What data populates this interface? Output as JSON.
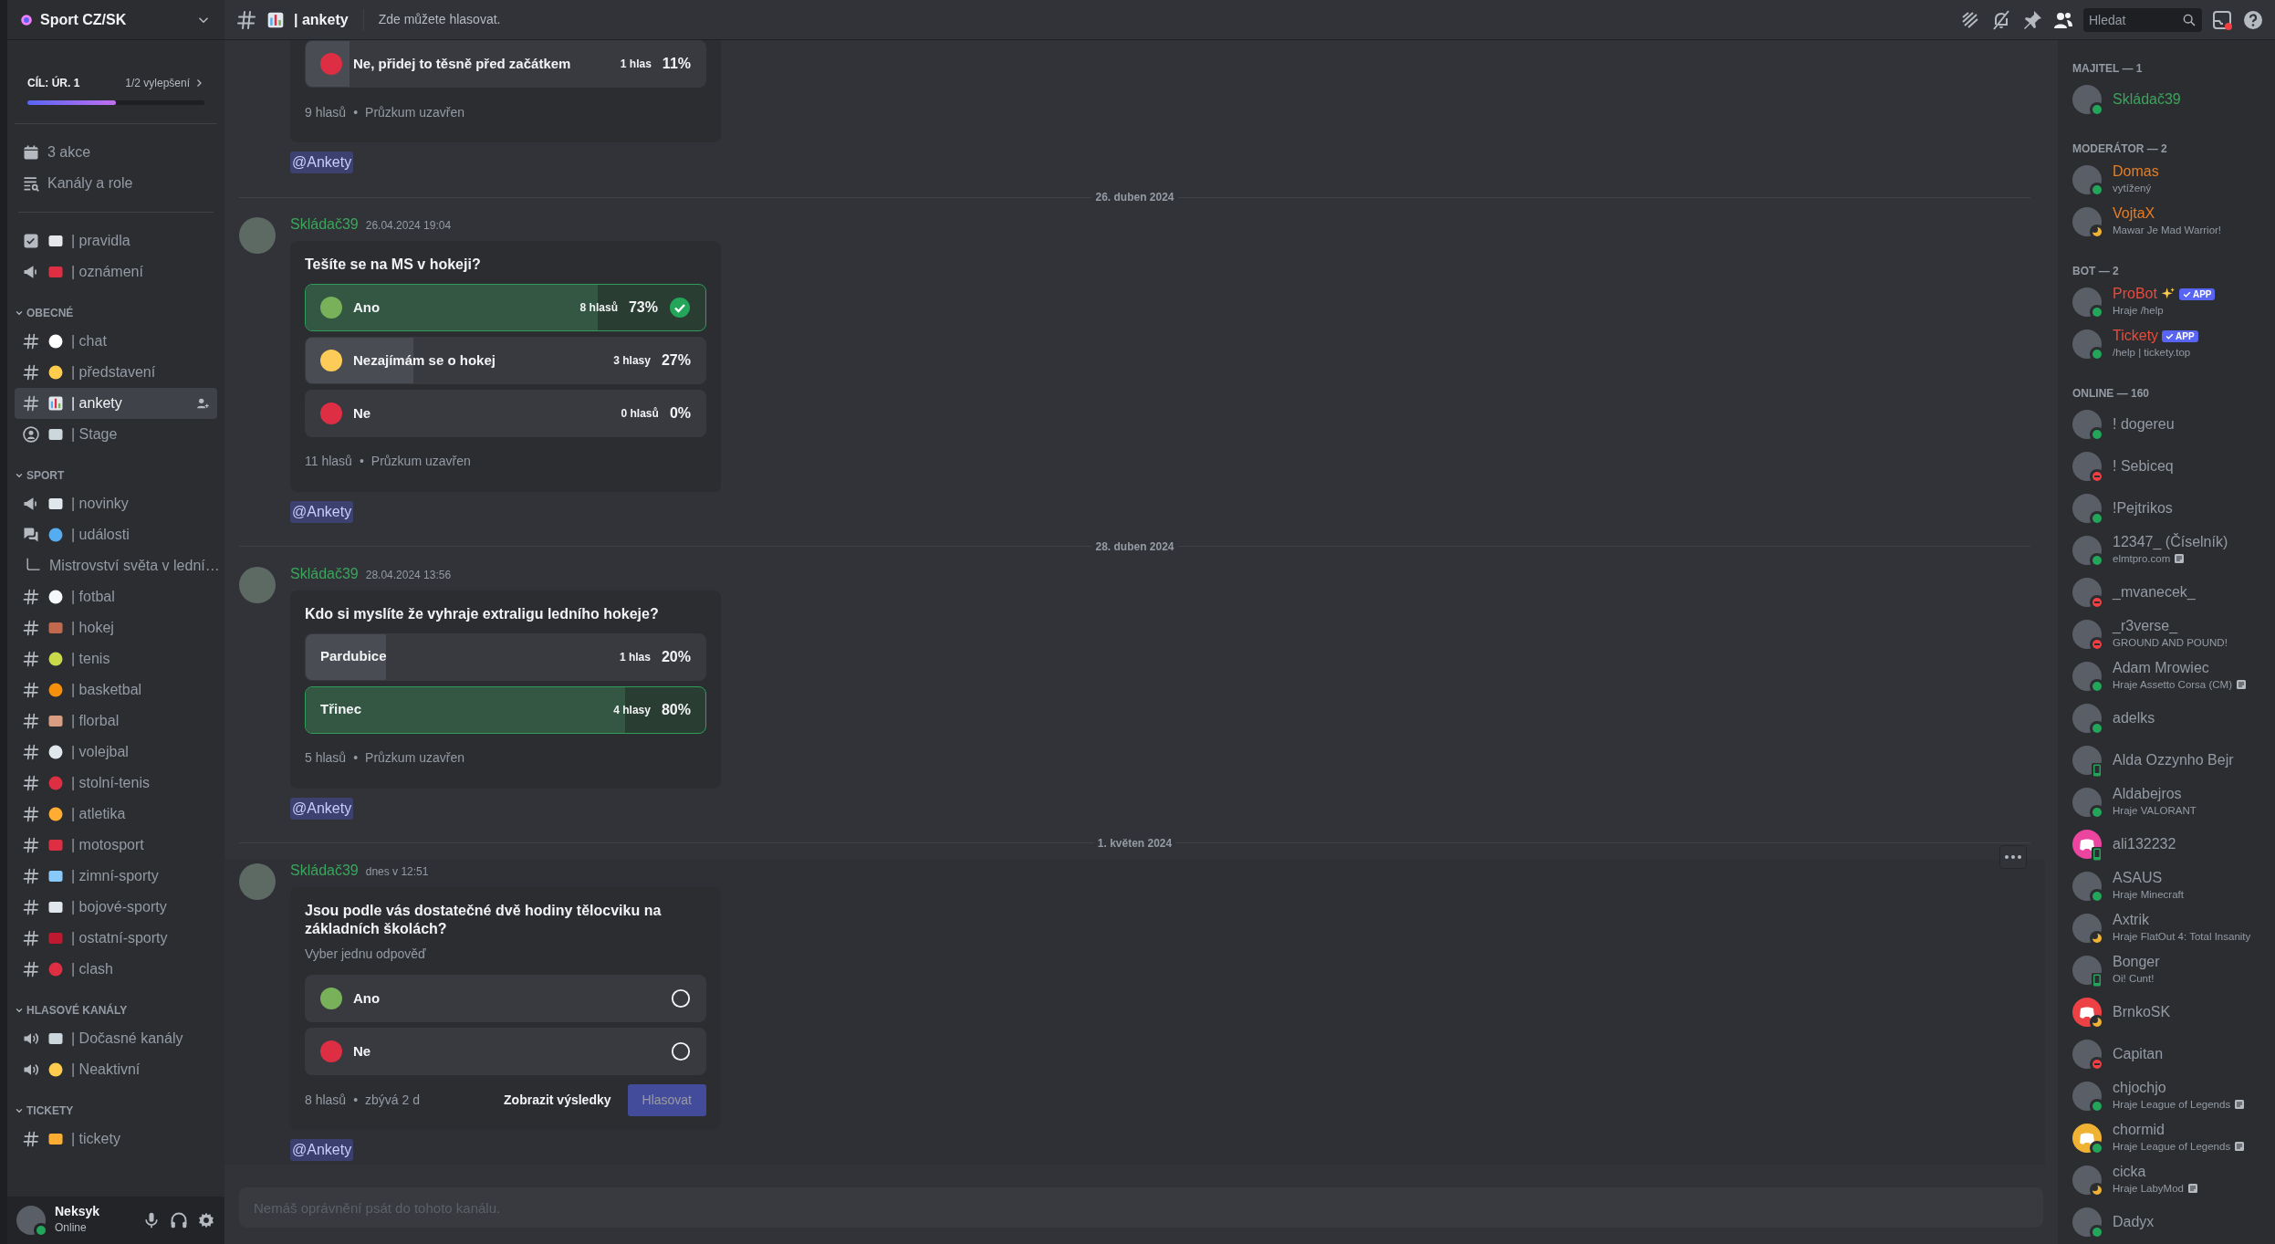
{
  "server": {
    "name": "Sport CZ/SK"
  },
  "boost": {
    "goal": "CÍL: ÚR. 1",
    "progress": "1/2 vylepšení",
    "level": 0.5
  },
  "shortcuts": [
    {
      "kind": "events",
      "label": "3 akce"
    },
    {
      "kind": "browse",
      "label": "Kanály a role"
    }
  ],
  "top_channels": [
    {
      "kind": "rules",
      "emoji": {
        "kind": "page"
      },
      "label": "| pravidla",
      "selected": false
    },
    {
      "kind": "announcement",
      "emoji": {
        "kind": "megaphone"
      },
      "label": "| oznámení",
      "selected": false
    }
  ],
  "categories": [
    {
      "name": "OBECNÉ",
      "expanded": true,
      "channels": [
        {
          "kind": "text",
          "emoji": {
            "kind": "speech"
          },
          "label": "| chat",
          "selected": false
        },
        {
          "kind": "text",
          "emoji": {
            "kind": "wave"
          },
          "label": "| představení",
          "selected": false
        },
        {
          "kind": "text",
          "emoji": {
            "kind": "chart"
          },
          "label": "| ankety",
          "selected": true
        },
        {
          "kind": "stage",
          "emoji": {
            "kind": "speaker"
          },
          "label": "| Stage",
          "selected": false
        }
      ]
    },
    {
      "name": "SPORT",
      "expanded": true,
      "channels": [
        {
          "kind": "announcement",
          "emoji": {
            "kind": "newspaper"
          },
          "label": "| novinky",
          "selected": false
        },
        {
          "kind": "forum",
          "emoji": {
            "kind": "globe"
          },
          "label": "| události",
          "selected": false
        },
        {
          "kind": "thread",
          "label": "Mistrovství světa v lední…",
          "selected": false
        },
        {
          "kind": "text",
          "emoji": {
            "kind": "soccer"
          },
          "label": "| fotbal",
          "selected": false
        },
        {
          "kind": "text",
          "emoji": {
            "kind": "hockey"
          },
          "label": "| hokej",
          "selected": false
        },
        {
          "kind": "text",
          "emoji": {
            "kind": "tennis"
          },
          "label": "| tenis",
          "selected": false
        },
        {
          "kind": "text",
          "emoji": {
            "kind": "basketball"
          },
          "label": "| basketbal",
          "selected": false
        },
        {
          "kind": "text",
          "emoji": {
            "kind": "stick"
          },
          "label": "| florbal",
          "selected": false
        },
        {
          "kind": "text",
          "emoji": {
            "kind": "volleyball"
          },
          "label": "| volejbal",
          "selected": false
        },
        {
          "kind": "text",
          "emoji": {
            "kind": "pingpong"
          },
          "label": "| stolní-tenis",
          "selected": false
        },
        {
          "kind": "text",
          "emoji": {
            "kind": "runner"
          },
          "label": "| atletika",
          "selected": false
        },
        {
          "kind": "text",
          "emoji": {
            "kind": "car"
          },
          "label": "| motosport",
          "selected": false
        },
        {
          "kind": "text",
          "emoji": {
            "kind": "snowboard"
          },
          "label": "| zimní-sporty",
          "selected": false
        },
        {
          "kind": "text",
          "emoji": {
            "kind": "gi"
          },
          "label": "| bojové-sporty",
          "selected": false
        },
        {
          "kind": "text",
          "emoji": {
            "kind": "goal"
          },
          "label": "| ostatní-sporty",
          "selected": false
        },
        {
          "kind": "text",
          "emoji": {
            "kind": "glove"
          },
          "label": "| clash",
          "selected": false
        }
      ]
    },
    {
      "name": "HLASOVÉ KANÁLY",
      "expanded": true,
      "channels": [
        {
          "kind": "voice",
          "emoji": {
            "kind": "speaker"
          },
          "label": "| Dočasné kanály",
          "selected": false
        },
        {
          "kind": "voice",
          "emoji": {
            "kind": "sleepy"
          },
          "label": "| Neaktivní",
          "selected": false
        }
      ]
    },
    {
      "name": "TICKETY",
      "expanded": true,
      "channels": [
        {
          "kind": "text",
          "emoji": {
            "kind": "ticket"
          },
          "label": "| tickety",
          "selected": false
        }
      ]
    }
  ],
  "user": {
    "name": "Neksyk",
    "status": "Online",
    "presence": {
      "kind": "online"
    }
  },
  "header": {
    "emoji": {
      "kind": "chart"
    },
    "name": "| ankety",
    "topic": "Zde můžete hlasovat.",
    "search_placeholder": "Hledat"
  },
  "messages": [
    {
      "continued": true,
      "hovered": false,
      "poll": {
        "kind": "results",
        "answers": [
          {
            "label": "Ne, přidej to těsně před začátkem",
            "color": "#dd2e44",
            "votes": "1 hlas",
            "percent": "11%",
            "level": 0.11,
            "winner": false,
            "voted": false
          }
        ],
        "total": "9 hlasů",
        "separator": "•",
        "status": "Průzkum uzavřen"
      },
      "mention": "@Ankety"
    },
    {
      "divider": "26. duben 2024",
      "author": {
        "name": "Skládač39",
        "color": "#3ba55c"
      },
      "time": "26.04.2024 19:04",
      "hovered": false,
      "poll": {
        "kind": "results",
        "question": "Tešíte se na MS v hokeji?",
        "answers": [
          {
            "label": "Ano",
            "color": "#78b159",
            "votes": "8 hlasů",
            "percent": "73%",
            "level": 0.73,
            "winner": true,
            "voted": true
          },
          {
            "label": "Nezajímám se o hokej",
            "color": "#fdcb58",
            "votes": "3 hlasy",
            "percent": "27%",
            "level": 0.27,
            "winner": false,
            "voted": false
          },
          {
            "label": "Ne",
            "color": "#dd2e44",
            "votes": "0 hlasů",
            "percent": "0%",
            "level": 0,
            "winner": false,
            "voted": false
          }
        ],
        "total": "11 hlasů",
        "separator": "•",
        "status": "Průzkum uzavřen"
      },
      "mention": "@Ankety"
    },
    {
      "divider": "28. duben 2024",
      "author": {
        "name": "Skládač39",
        "color": "#3ba55c"
      },
      "time": "28.04.2024 13:56",
      "hovered": false,
      "poll": {
        "kind": "results",
        "question": "Kdo si myslíte že vyhraje extraligu ledního hokeje?",
        "answers": [
          {
            "label": "Pardubice",
            "votes": "1 hlas",
            "percent": "20%",
            "level": 0.2,
            "winner": false,
            "voted": false
          },
          {
            "label": "Třinec",
            "votes": "4 hlasy",
            "percent": "80%",
            "level": 0.8,
            "winner": true,
            "voted": false
          }
        ],
        "total": "5 hlasů",
        "separator": "•",
        "status": "Průzkum uzavřen"
      },
      "mention": "@Ankety"
    },
    {
      "divider": "1. květen 2024",
      "author": {
        "name": "Skládač39",
        "color": "#3ba55c"
      },
      "time": "dnes v 12:51",
      "hovered": true,
      "poll": {
        "kind": "open",
        "question": "Jsou podle vás dostatečné dvě hodiny tělocviku na základních školách?",
        "hint": "Vyber jednu odpověď",
        "answers": [
          {
            "label": "Ano",
            "color": "#78b159",
            "checked": false
          },
          {
            "label": "Ne",
            "color": "#dd2e44",
            "checked": false
          }
        ],
        "total": "8 hlasů",
        "separator": "•",
        "status": "zbývá 2 d",
        "buttons": [
          {
            "kind": "link",
            "label": "Zobrazit výsledky",
            "disabled": false
          },
          {
            "kind": "primary",
            "label": "Hlasovat",
            "disabled": true
          }
        ]
      },
      "mention": "@Ankety"
    }
  ],
  "composer": {
    "placeholder": "Nemáš oprávnění psát do tohoto kanálu."
  },
  "member_groups": [
    {
      "title": "MAJITEL — 1",
      "members": [
        {
          "name": "Skládač39",
          "color": "#3ba55c",
          "presence": {
            "kind": "online"
          },
          "avatar": {
            "kind": "photo"
          }
        }
      ]
    },
    {
      "title": "MODERÁTOR — 2",
      "members": [
        {
          "name": "Domas",
          "color": "#e67e22",
          "presence": {
            "kind": "online"
          },
          "activity": "vytížený",
          "avatar": {
            "kind": "photo"
          }
        },
        {
          "name": "VojtaX",
          "color": "#e67e22",
          "presence": {
            "kind": "idle"
          },
          "activity": "Mawar Je Mad Warrior!",
          "avatar": {
            "kind": "photo"
          }
        }
      ]
    },
    {
      "title": "BOT — 2",
      "members": [
        {
          "name": "ProBot",
          "color": "#e74c3c",
          "sparkle": true,
          "badge": "APP",
          "presence": {
            "kind": "online"
          },
          "activity": "Hraje /help",
          "avatar": {
            "kind": "photo"
          }
        },
        {
          "name": "Tickety",
          "color": "#e74c3c",
          "badge": "APP",
          "presence": {
            "kind": "online"
          },
          "activity": "/help | tickety.top",
          "avatar": {
            "kind": "photo"
          }
        }
      ]
    },
    {
      "title": "ONLINE — 160",
      "members": [
        {
          "name": "! dogereu",
          "presence": {
            "kind": "online"
          },
          "avatar": {
            "kind": "photo"
          }
        },
        {
          "name": "! Sebiceq",
          "presence": {
            "kind": "dnd"
          },
          "avatar": {
            "kind": "photo"
          }
        },
        {
          "name": "!Pejtrikos",
          "presence": {
            "kind": "online"
          },
          "avatar": {
            "kind": "photo"
          }
        },
        {
          "name": "12347_ (Číselník)",
          "presence": {
            "kind": "online"
          },
          "activity": "elmtpro.com",
          "rich": true,
          "avatar": {
            "kind": "photo"
          }
        },
        {
          "name": "_mvanecek_",
          "presence": {
            "kind": "dnd"
          },
          "avatar": {
            "kind": "photo"
          }
        },
        {
          "name": "_r3verse_",
          "presence": {
            "kind": "dnd"
          },
          "activity": "GROUND AND POUND!",
          "avatar": {
            "kind": "photo"
          }
        },
        {
          "name": "Adam Mrowiec",
          "presence": {
            "kind": "online"
          },
          "activity": "Hraje Assetto Corsa (CM)",
          "rich": true,
          "avatar": {
            "kind": "photo"
          }
        },
        {
          "name": "adelks",
          "presence": {
            "kind": "online"
          },
          "avatar": {
            "kind": "photo"
          }
        },
        {
          "name": "Alda Ozzynho Bejr",
          "presence": {
            "kind": "mobile"
          },
          "avatar": {
            "kind": "photo"
          }
        },
        {
          "name": "Aldabejros",
          "presence": {
            "kind": "online"
          },
          "activity": "Hraje VALORANT",
          "avatar": {
            "kind": "photo"
          }
        },
        {
          "name": "ali132232",
          "presence": {
            "kind": "mobile"
          },
          "avatar": {
            "kind": "default",
            "color": "#eb459f"
          }
        },
        {
          "name": "ASAUS",
          "presence": {
            "kind": "online"
          },
          "activity": "Hraje Minecraft",
          "avatar": {
            "kind": "photo"
          }
        },
        {
          "name": "Axtrik",
          "presence": {
            "kind": "idle"
          },
          "activity": "Hraje FlatOut 4: Total Insanity",
          "avatar": {
            "kind": "photo"
          }
        },
        {
          "name": "Bonger",
          "presence": {
            "kind": "mobile"
          },
          "activity": "Oi! Cunt!",
          "avatar": {
            "kind": "photo"
          }
        },
        {
          "name": "BrnkoSK",
          "presence": {
            "kind": "idle"
          },
          "avatar": {
            "kind": "default",
            "color": "#ed4245"
          }
        },
        {
          "name": "Capitan",
          "presence": {
            "kind": "dnd"
          },
          "avatar": {
            "kind": "photo"
          }
        },
        {
          "name": "chjochjo",
          "presence": {
            "kind": "online"
          },
          "activity": "Hraje League of Legends",
          "rich": true,
          "avatar": {
            "kind": "photo"
          }
        },
        {
          "name": "chormid",
          "presence": {
            "kind": "online"
          },
          "activity": "Hraje League of Legends",
          "rich": true,
          "avatar": {
            "kind": "default",
            "color": "#f0b232"
          }
        },
        {
          "name": "cicka",
          "presence": {
            "kind": "idle"
          },
          "activity": "Hraje LabyMod",
          "rich": true,
          "avatar": {
            "kind": "photo"
          }
        },
        {
          "name": "Dadyx",
          "presence": {
            "kind": "online"
          },
          "avatar": {
            "kind": "photo"
          }
        }
      ]
    }
  ]
}
